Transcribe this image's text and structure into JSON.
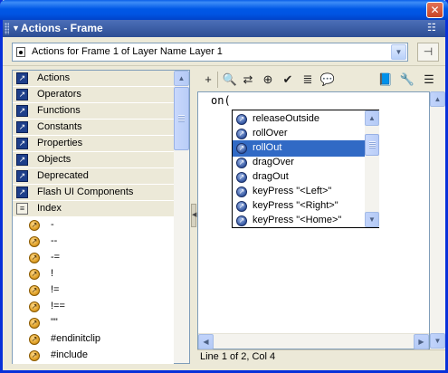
{
  "window": {
    "close_glyph": "✕"
  },
  "panel": {
    "title": "Actions - Frame",
    "collapse_icon": "triangle-down-icon",
    "menu_icon": "panel-options-icon"
  },
  "target": {
    "label": "Actions for Frame 1 of Layer Name Layer 1",
    "icon": "frame-icon",
    "pin_icon": "pin-icon"
  },
  "toolbox": {
    "categories": [
      {
        "label": "Actions"
      },
      {
        "label": "Operators"
      },
      {
        "label": "Functions"
      },
      {
        "label": "Constants"
      },
      {
        "label": "Properties"
      },
      {
        "label": "Objects"
      },
      {
        "label": "Deprecated"
      },
      {
        "label": "Flash UI Components"
      },
      {
        "label": "Index"
      }
    ],
    "index_items": [
      "-",
      "--",
      "-=",
      "!",
      "!=",
      "!==",
      "\"\"",
      "#endinitclip",
      "#include"
    ]
  },
  "toolbar": {
    "buttons": [
      {
        "name": "add-item-icon",
        "glyph": "+"
      },
      {
        "name": "find-icon",
        "glyph": "🔍"
      },
      {
        "name": "replace-icon",
        "glyph": "⇄"
      },
      {
        "name": "target-path-icon",
        "glyph": "⊕"
      },
      {
        "name": "check-syntax-icon",
        "glyph": "✔"
      },
      {
        "name": "auto-format-icon",
        "glyph": "≣"
      },
      {
        "name": "show-code-hint-icon",
        "glyph": "💬"
      },
      {
        "name": "reference-icon",
        "glyph": "📘"
      },
      {
        "name": "debug-options-icon",
        "glyph": "🔧"
      },
      {
        "name": "view-options-icon",
        "glyph": "☰"
      }
    ]
  },
  "editor": {
    "code": "on(",
    "status": "Line 1 of 2, Col 4"
  },
  "code_hint": {
    "items": [
      "releaseOutside",
      "rollOver",
      "rollOut",
      "dragOver",
      "dragOut",
      "keyPress \"<Left>\"",
      "keyPress \"<Right>\"",
      "keyPress \"<Home>\""
    ],
    "selected_index": 2
  }
}
